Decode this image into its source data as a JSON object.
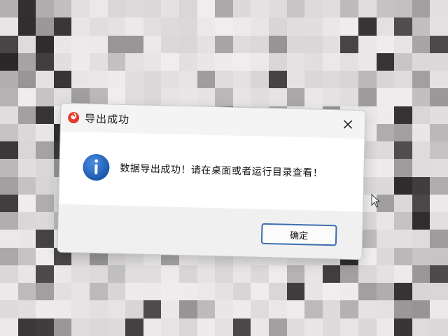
{
  "dialog": {
    "title": "导出成功",
    "close_label": "×",
    "message": "数据导出成功！请在桌面或者运行目录查看！",
    "ok_label": "确定",
    "icons": {
      "app_logo": "app-logo-icon",
      "info": "info-icon",
      "close": "close-icon"
    },
    "colors": {
      "info_icon": "#1f64c2",
      "app_logo": "#e43b2c",
      "button_border": "#3c6fb0"
    }
  }
}
